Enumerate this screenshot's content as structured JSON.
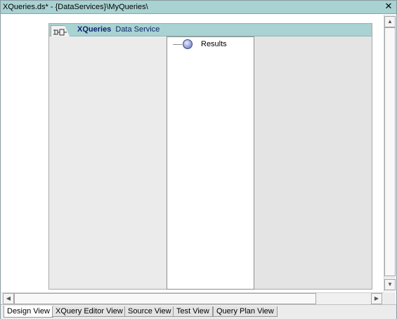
{
  "window": {
    "title": "XQueries.ds* - {DataServices}\\MyQueries\\",
    "close_glyph": "✕"
  },
  "data_service": {
    "icon": "data-service-icon",
    "name": "XQueries",
    "type_label": "Data Service"
  },
  "results_node": {
    "label": "Results",
    "icon": "results-sphere-icon"
  },
  "scrollbars": {
    "up_arrow": "▲",
    "down_arrow": "▼",
    "left_arrow": "◀",
    "right_arrow": "▶"
  },
  "tabs": [
    {
      "label": "Design View",
      "active": true
    },
    {
      "label": "XQuery Editor View",
      "active": false
    },
    {
      "label": "Source View",
      "active": false
    },
    {
      "label": "Test View",
      "active": false
    },
    {
      "label": "Query Plan View",
      "active": false
    }
  ],
  "colors": {
    "titlebar_bg": "#a9d2d2",
    "panel_header_bg": "#a9d2d2",
    "service_title": "#0b2370"
  }
}
